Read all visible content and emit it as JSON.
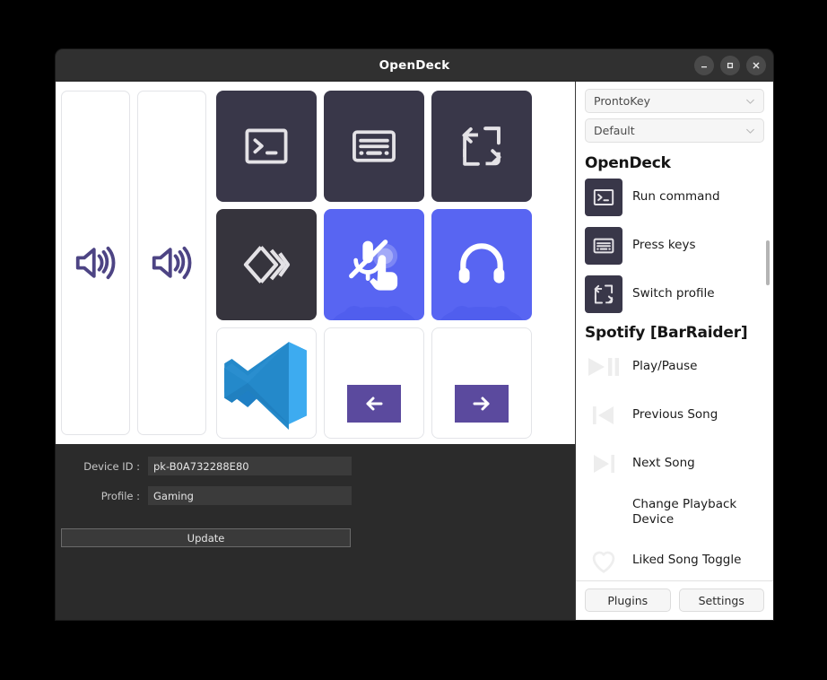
{
  "window": {
    "title": "OpenDeck",
    "controls": [
      {
        "name": "minimize",
        "label": "–"
      },
      {
        "name": "maximize",
        "label": "□"
      },
      {
        "name": "close",
        "label": "✕"
      }
    ]
  },
  "deck": {
    "sliders": [
      {
        "icon": "volume-speaker-icon",
        "color": "#4d4484"
      },
      {
        "icon": "volume-speaker-icon",
        "color": "#4d4484"
      }
    ],
    "keys": [
      {
        "icon": "terminal-icon",
        "style": "dark",
        "label": "Run command"
      },
      {
        "icon": "keyboard-icon",
        "style": "dark",
        "label": "Press keys"
      },
      {
        "icon": "switch-profile-icon",
        "style": "dark",
        "label": "Switch profile"
      },
      {
        "icon": "chevrons-diamond-icon",
        "style": "dark2",
        "label": ""
      },
      {
        "icon": "mic-mute-push-icon",
        "style": "discord",
        "label": ""
      },
      {
        "icon": "headset-icon",
        "style": "discord",
        "label": ""
      },
      {
        "icon": "vscode-icon",
        "style": "white",
        "label": ""
      },
      {
        "icon": "arrow-left-icon",
        "style": "white",
        "label": ""
      },
      {
        "icon": "arrow-right-icon",
        "style": "white",
        "label": ""
      }
    ]
  },
  "form": {
    "device_id_label": "Device ID :",
    "device_id_value": "pk-B0A732288E80",
    "profile_label": "Profile :",
    "profile_value": "Gaming",
    "update_label": "Update"
  },
  "actions": {
    "device_select": "ProntoKey",
    "profile_select": "Default",
    "groups": [
      {
        "title": "OpenDeck",
        "items": [
          {
            "label": "Run command",
            "icon": "terminal-icon",
            "icon_style": "tile"
          },
          {
            "label": "Press keys",
            "icon": "keyboard-icon",
            "icon_style": "tile"
          },
          {
            "label": "Switch profile",
            "icon": "switch-profile-icon",
            "icon_style": "tile"
          }
        ]
      },
      {
        "title": "Spotify [BarRaider]",
        "items": [
          {
            "label": "Play/Pause",
            "icon": "play-pause-icon",
            "icon_style": "plain"
          },
          {
            "label": "Previous Song",
            "icon": "previous-icon",
            "icon_style": "plain"
          },
          {
            "label": "Next Song",
            "icon": "next-icon",
            "icon_style": "plain"
          },
          {
            "label": "Change Playback Device",
            "icon": "speaker-icon",
            "icon_style": "plain"
          },
          {
            "label": "Liked Song Toggle",
            "icon": "heart-icon",
            "icon_style": "plain"
          }
        ]
      }
    ],
    "footer": {
      "plugins_label": "Plugins",
      "settings_label": "Settings"
    }
  },
  "colors": {
    "titlebar": "#303030",
    "panel_dark": "#2b2b2b",
    "key_dark": "#393749",
    "discord_blurple": "#5865f2",
    "slider_icon_purple": "#4d4484",
    "arrow_purple": "#5b4a9e"
  }
}
